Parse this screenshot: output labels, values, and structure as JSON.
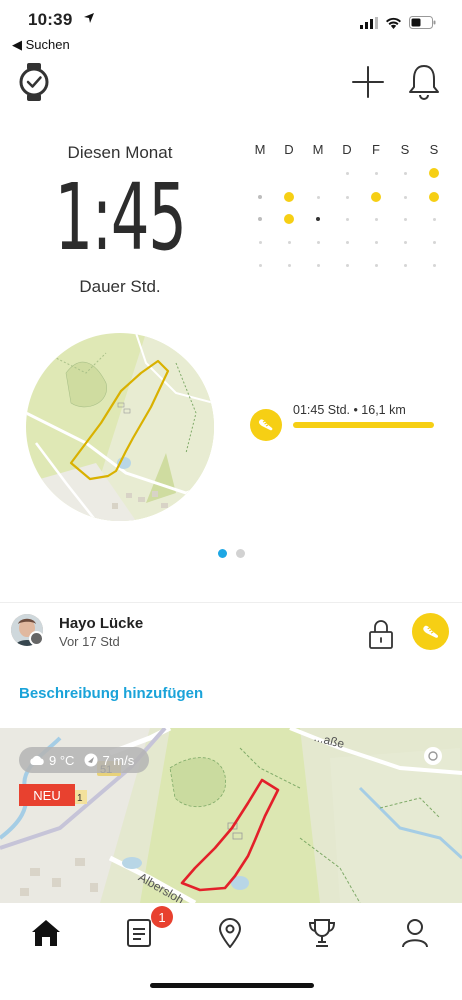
{
  "status_bar": {
    "time": "10:39",
    "back_label": "◀ Suchen"
  },
  "summary": {
    "month_label": "Diesen Monat",
    "duration": "1:45",
    "duration_unit": "Dauer Std."
  },
  "calendar": {
    "weekdays": [
      "M",
      "D",
      "M",
      "D",
      "F",
      "S",
      "S"
    ],
    "rows": [
      [
        "none",
        "none",
        "none",
        "empty",
        "empty",
        "empty",
        "active"
      ],
      [
        "rest",
        "active",
        "empty",
        "empty",
        "active",
        "empty",
        "active"
      ],
      [
        "rest",
        "active",
        "today",
        "empty",
        "empty",
        "empty",
        "empty"
      ],
      [
        "empty",
        "empty",
        "empty",
        "empty",
        "empty",
        "empty",
        "empty"
      ],
      [
        "empty",
        "empty",
        "empty",
        "empty",
        "empty",
        "empty",
        "empty"
      ]
    ]
  },
  "activity": {
    "summary": "01:45 Std. • 16,1 km",
    "bar_fraction": 1.0
  },
  "pager": {
    "count": 2,
    "active_index": 0
  },
  "feed_item": {
    "user_name": "Hayo Lücke",
    "time_ago": "Vor 17 Std",
    "add_description": "Beschreibung hinzufügen",
    "weather": {
      "temperature": "9 °C",
      "wind": "7 m/s"
    },
    "new_badge": "NEU",
    "map_labels": {
      "street_1": "Albersloh...",
      "street_2": "...aße"
    }
  },
  "tab_bar": {
    "tabs": [
      "home-icon",
      "diary-icon",
      "map-pin-icon",
      "trophy-icon",
      "profile-icon"
    ],
    "active": "home-icon",
    "diary_badge": "1"
  },
  "colors": {
    "accent_yellow": "#f6cf14",
    "link_blue": "#1aa3d9",
    "route_red": "#e3202a",
    "badge_red": "#e8412f",
    "map_green": "#dfe8b5"
  }
}
